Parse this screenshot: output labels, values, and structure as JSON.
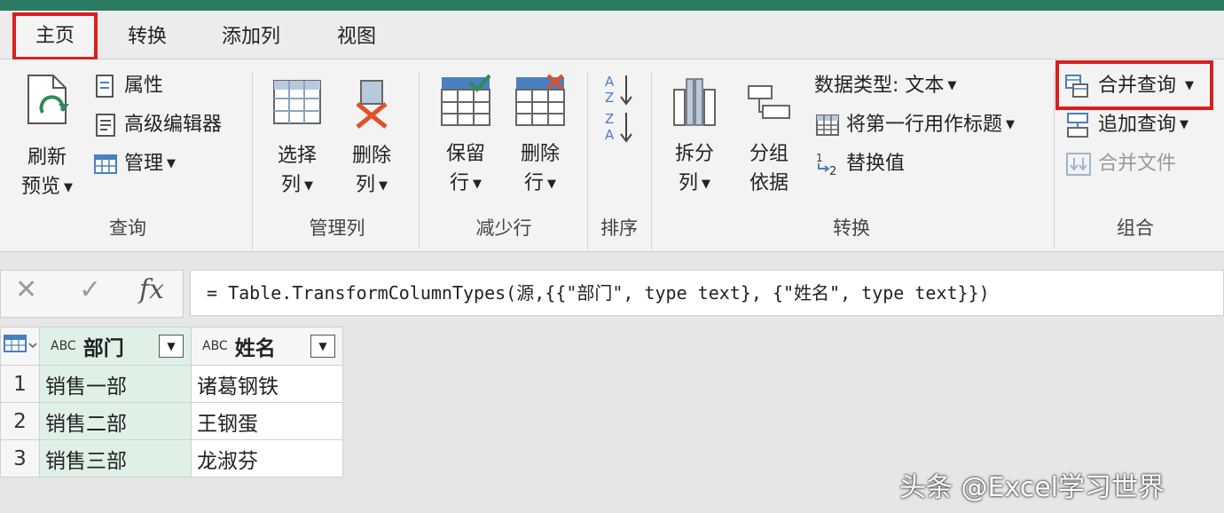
{
  "tabs": [
    "主页",
    "转换",
    "添加列",
    "视图"
  ],
  "ribbon": {
    "query": {
      "refresh_l1": "刷新",
      "refresh_l2": "预览",
      "properties": "属性",
      "advanced_editor": "高级编辑器",
      "manage": "管理",
      "group_label": "查询"
    },
    "manage_columns": {
      "choose_l1": "选择",
      "choose_l2": "列",
      "remove_l1": "删除",
      "remove_l2": "列",
      "group_label": "管理列"
    },
    "reduce_rows": {
      "keep_l1": "保留",
      "keep_l2": "行",
      "remove_l1": "删除",
      "remove_l2": "行",
      "group_label": "减少行"
    },
    "sort": {
      "group_label": "排序"
    },
    "transform": {
      "split_l1": "拆分",
      "split_l2": "列",
      "groupby_l1": "分组",
      "groupby_l2": "依据",
      "data_type": "数据类型: 文本",
      "first_row_header": "将第一行用作标题",
      "replace_values": "替换值",
      "group_label": "转换"
    },
    "combine": {
      "merge_queries": "合并查询",
      "append_queries": "追加查询",
      "combine_files": "合并文件",
      "group_label": "组合"
    }
  },
  "formula": {
    "text": "= Table.TransformColumnTypes(源,{{\"部门\", type text}, {\"姓名\", type text}})"
  },
  "table": {
    "type_prefix": "ABC",
    "columns": [
      "部门",
      "姓名"
    ],
    "rows": [
      {
        "num": "1",
        "dept": "销售一部",
        "name": "诸葛钢铁"
      },
      {
        "num": "2",
        "dept": "销售二部",
        "name": "王钢蛋"
      },
      {
        "num": "3",
        "dept": "销售三部",
        "name": "龙淑芬"
      }
    ]
  },
  "watermark": "头条 @Excel学习世界"
}
